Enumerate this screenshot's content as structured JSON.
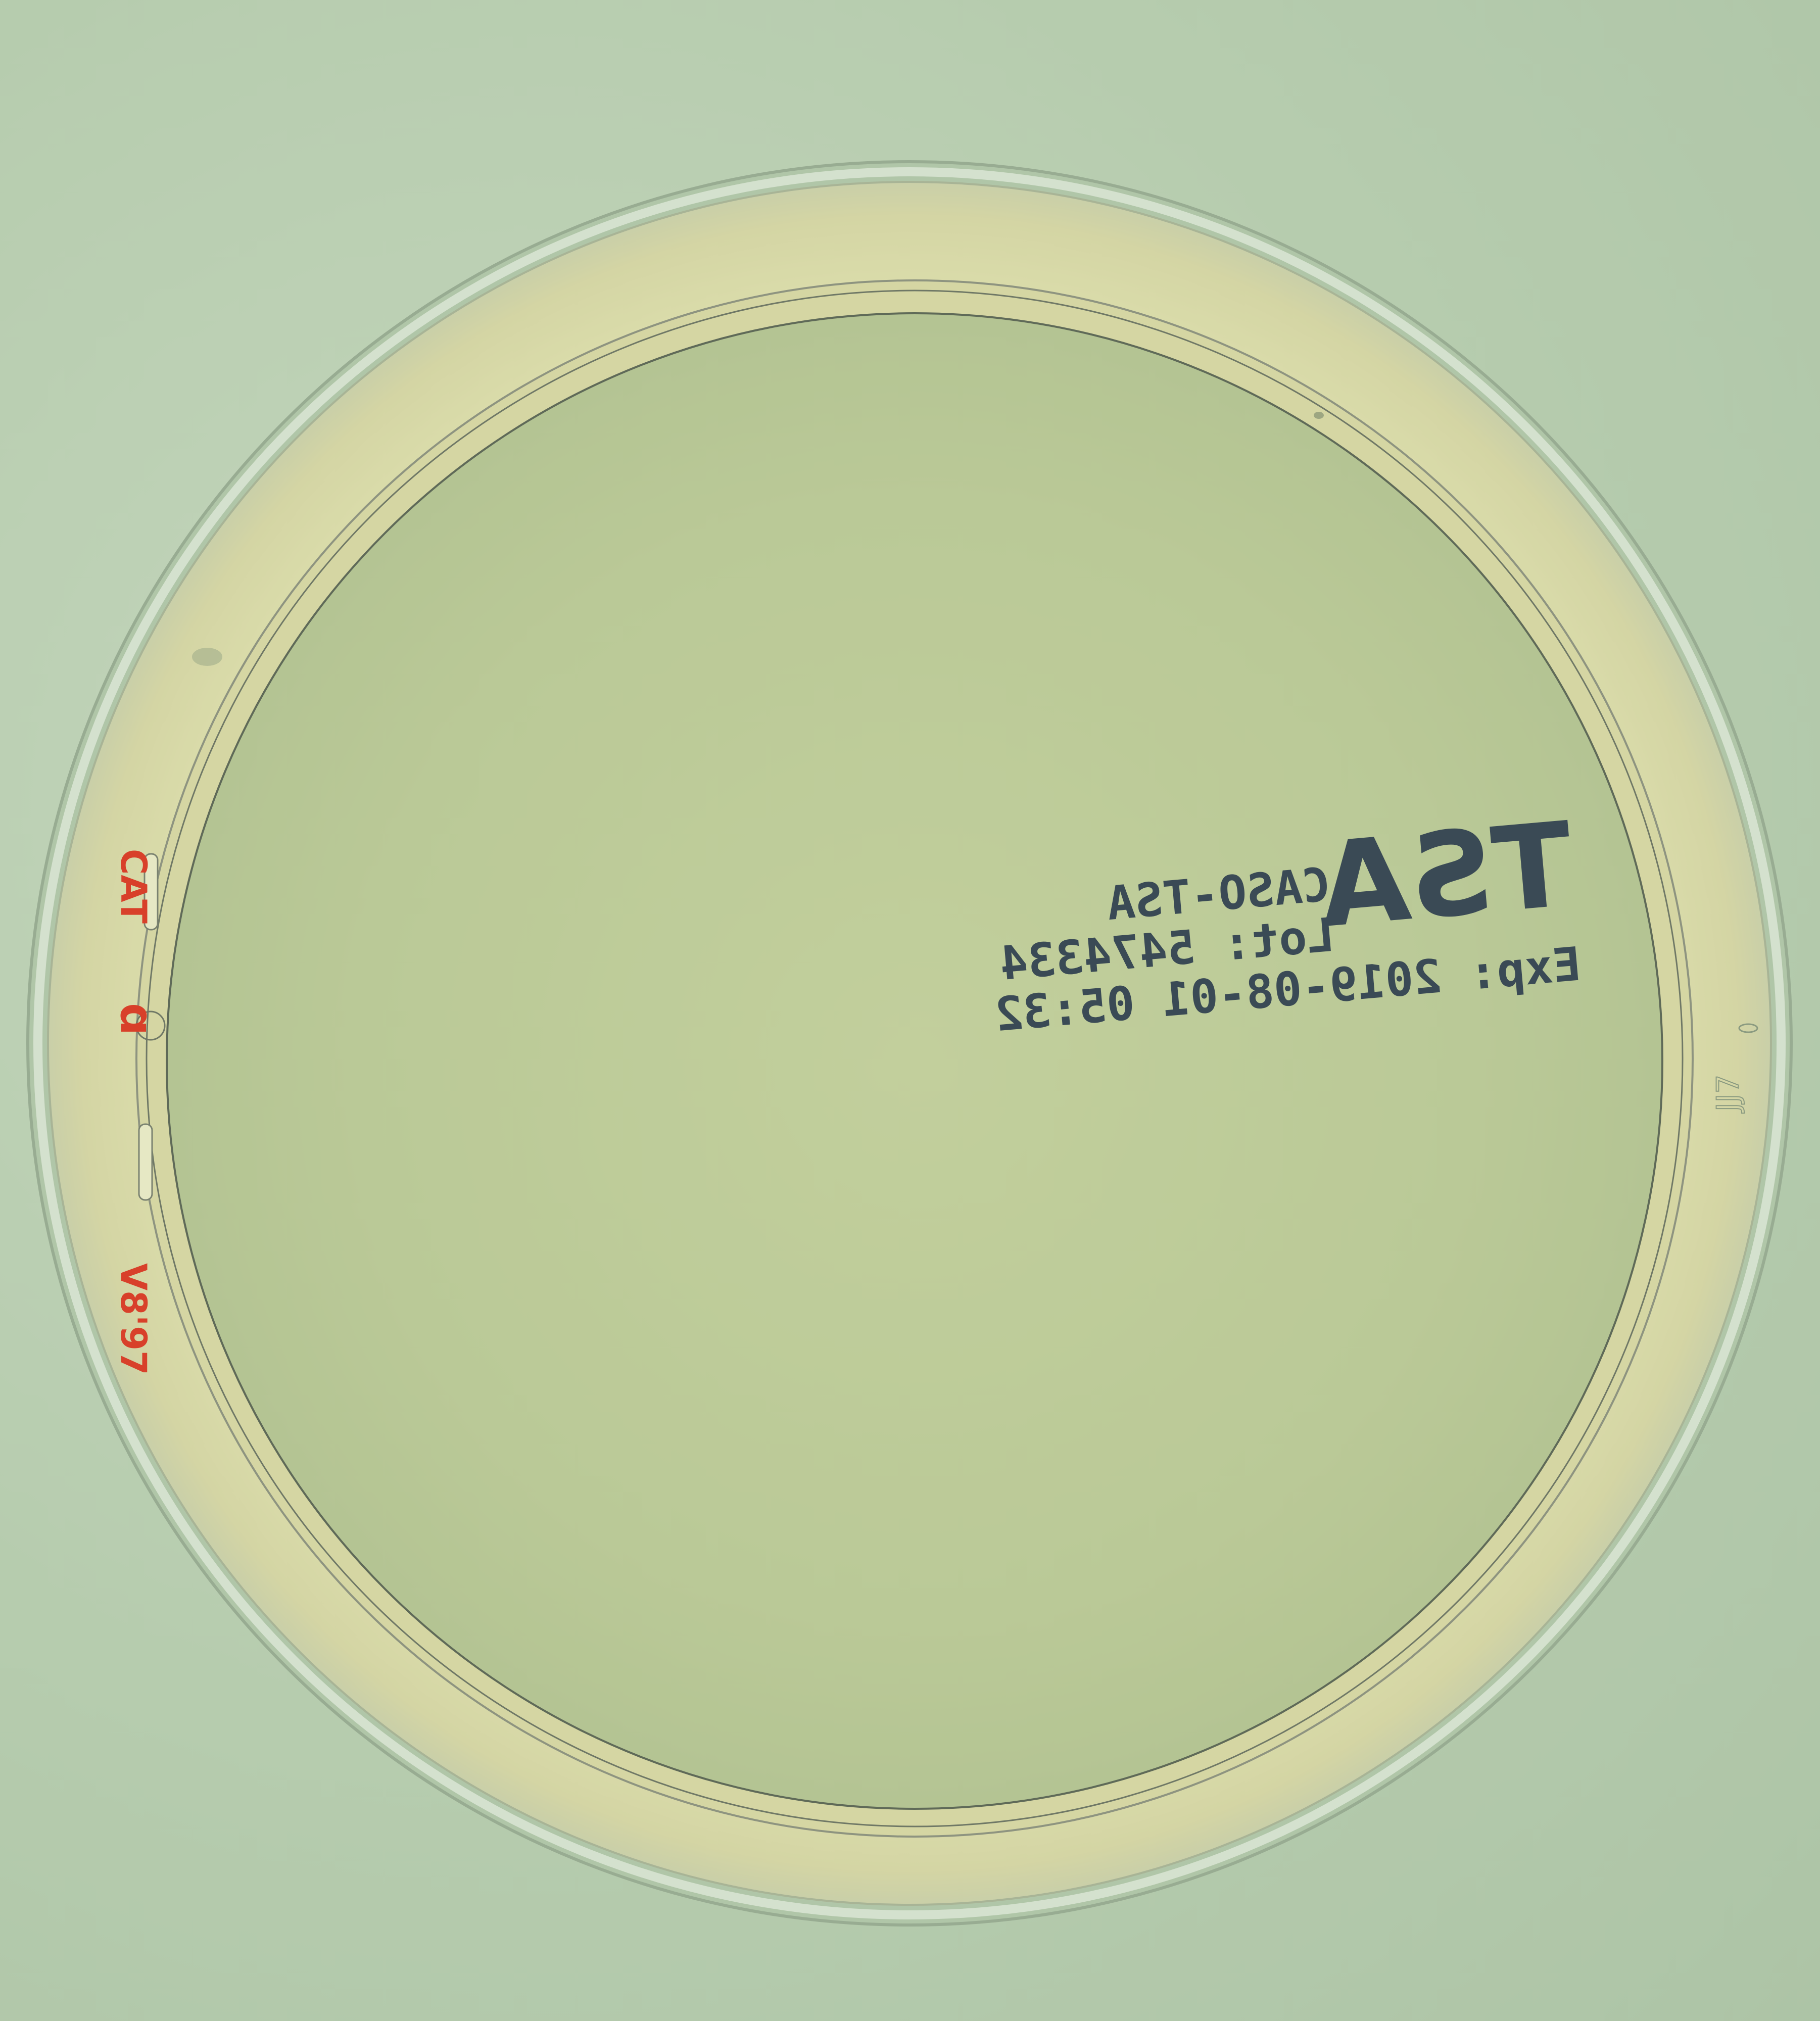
{
  "label": {
    "brand": "TSA",
    "line1": "CASO-TSA",
    "line2": "Lot: 5474334",
    "line3": "Exp: 2019-08-01   05:32"
  },
  "rim_marks": {
    "red_mark_1": "CAT",
    "red_mark_2": "ɑ",
    "red_mark_3": "V8'97",
    "emboss_mark": "JJ7"
  },
  "colors": {
    "background": "#b8ceb0",
    "agar": "#bdcc98",
    "rim": "#d8d9a8",
    "ink": "#3a4a55",
    "red_marker": "#d8402a"
  }
}
